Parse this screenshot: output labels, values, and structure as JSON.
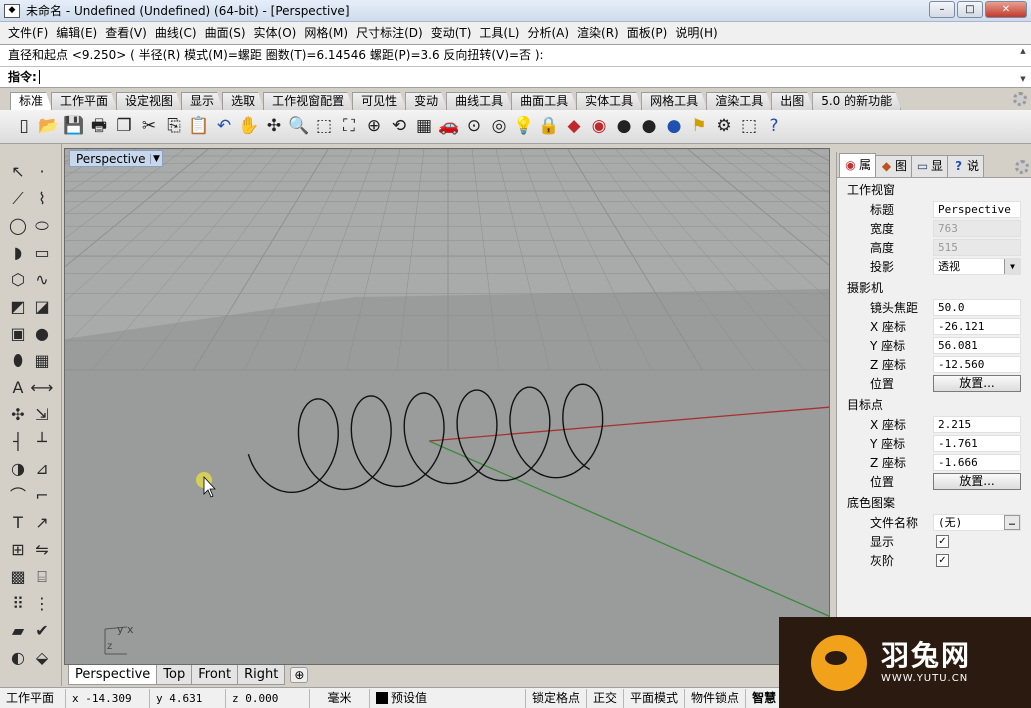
{
  "window": {
    "title": "未命名 - Undefined (Undefined) (64-bit) - [Perspective]",
    "buttons": [
      "–",
      "□",
      "✕"
    ]
  },
  "menu": [
    "文件(F)",
    "编辑(E)",
    "查看(V)",
    "曲线(C)",
    "曲面(S)",
    "实体(O)",
    "网格(M)",
    "尺寸标注(D)",
    "变动(T)",
    "工具(L)",
    "分析(A)",
    "渲染(R)",
    "面板(P)",
    "说明(H)"
  ],
  "command": {
    "history": "直径和起点 <9.250> ( 半径(R)  模式(M)=螺距  圈数(T)=6.14546  螺距(P)=3.6  反向扭转(V)=否 ):",
    "prompt": "指令:",
    "value": ""
  },
  "toolbar_tabs": [
    "标准",
    "工作平面",
    "设定视图",
    "显示",
    "选取",
    "工作视窗配置",
    "可见性",
    "变动",
    "曲线工具",
    "曲面工具",
    "实体工具",
    "网格工具",
    "渲染工具",
    "出图",
    "5.0 的新功能"
  ],
  "toolbar_icons": [
    {
      "name": "new-icon",
      "glyph": "▯"
    },
    {
      "name": "open-icon",
      "glyph": "📂"
    },
    {
      "name": "save-icon",
      "glyph": "💾"
    },
    {
      "name": "print-icon",
      "glyph": "🖶"
    },
    {
      "name": "copy-page-icon",
      "glyph": "❐"
    },
    {
      "name": "cut-icon",
      "glyph": "✂"
    },
    {
      "name": "copy-icon",
      "glyph": "⎘"
    },
    {
      "name": "paste-icon",
      "glyph": "📋"
    },
    {
      "name": "undo-icon",
      "glyph": "↶"
    },
    {
      "name": "pan-icon",
      "glyph": "✋"
    },
    {
      "name": "rotate-view-icon",
      "glyph": "✣"
    },
    {
      "name": "zoom-icon",
      "glyph": "🔍"
    },
    {
      "name": "zoom-window-icon",
      "glyph": "⬚"
    },
    {
      "name": "zoom-extents-icon",
      "glyph": "⛶"
    },
    {
      "name": "zoom-selected-icon",
      "glyph": "⊕"
    },
    {
      "name": "undo-view-icon",
      "glyph": "⟲"
    },
    {
      "name": "grid-icon",
      "glyph": "▦"
    },
    {
      "name": "car-icon",
      "glyph": "🚗"
    },
    {
      "name": "camera-icon",
      "glyph": "⊙"
    },
    {
      "name": "target-icon",
      "glyph": "◎"
    },
    {
      "name": "light-icon",
      "glyph": "💡"
    },
    {
      "name": "layer-icon",
      "glyph": "🔒"
    },
    {
      "name": "layer-color-icon",
      "glyph": "◆"
    },
    {
      "name": "color-wheel-icon",
      "glyph": "◉"
    },
    {
      "name": "sphere-wire-icon",
      "glyph": "●"
    },
    {
      "name": "sphere-shaded-icon",
      "glyph": "●"
    },
    {
      "name": "sphere-render-icon",
      "glyph": "●"
    },
    {
      "name": "flag-icon",
      "glyph": "⚑"
    },
    {
      "name": "options-icon",
      "glyph": "⚙"
    },
    {
      "name": "select-all-icon",
      "glyph": "⬚"
    },
    {
      "name": "help-icon",
      "glyph": "?"
    }
  ],
  "left_tools": [
    [
      {
        "name": "select-arrow-icon",
        "glyph": "↖"
      },
      {
        "name": "point-icon",
        "glyph": "·"
      }
    ],
    [
      {
        "name": "polyline-icon",
        "glyph": "⟋"
      },
      {
        "name": "curve-icon",
        "glyph": "⌇"
      }
    ],
    [
      {
        "name": "circle-icon",
        "glyph": "◯"
      },
      {
        "name": "ellipse-icon",
        "glyph": "⬭"
      }
    ],
    [
      {
        "name": "arc-icon",
        "glyph": "◗"
      },
      {
        "name": "rectangle-icon",
        "glyph": "▭"
      }
    ],
    [
      {
        "name": "polygon-icon",
        "glyph": "⬡"
      },
      {
        "name": "freeform-icon",
        "glyph": "∿"
      }
    ],
    [
      {
        "name": "surface-icon",
        "glyph": "◩"
      },
      {
        "name": "surface-edit-icon",
        "glyph": "◪"
      }
    ],
    [
      {
        "name": "box-icon",
        "glyph": "▣"
      },
      {
        "name": "sphere-icon",
        "glyph": "●"
      }
    ],
    [
      {
        "name": "cylinder-icon",
        "glyph": "⬮"
      },
      {
        "name": "mesh-icon",
        "glyph": "▦"
      }
    ],
    [
      {
        "name": "text-object-icon",
        "glyph": "A"
      },
      {
        "name": "dim-icon",
        "glyph": "⟷"
      }
    ],
    [
      {
        "name": "transform-icon",
        "glyph": "✣"
      },
      {
        "name": "move-icon",
        "glyph": "⇲"
      }
    ],
    [
      {
        "name": "trim-icon",
        "glyph": "┤"
      },
      {
        "name": "split-icon",
        "glyph": "┴"
      }
    ],
    [
      {
        "name": "boolean-icon",
        "glyph": "◑"
      },
      {
        "name": "offset-icon",
        "glyph": "⊿"
      }
    ],
    [
      {
        "name": "fillet-icon",
        "glyph": "⌒"
      },
      {
        "name": "chamfer-icon",
        "glyph": "⌐"
      }
    ],
    [
      {
        "name": "text-icon",
        "glyph": "T"
      },
      {
        "name": "leader-icon",
        "glyph": "↗"
      }
    ],
    [
      {
        "name": "array-icon",
        "glyph": "⊞"
      },
      {
        "name": "mirror-icon",
        "glyph": "⇋"
      }
    ],
    [
      {
        "name": "solid-box-icon",
        "glyph": "▩"
      },
      {
        "name": "analysis-icon",
        "glyph": "⌸"
      }
    ],
    [
      {
        "name": "grid-points-icon",
        "glyph": "⠿"
      },
      {
        "name": "control-points-icon",
        "glyph": "⋮"
      }
    ],
    [
      {
        "name": "layers-icon",
        "glyph": "▰"
      },
      {
        "name": "check-icon",
        "glyph": "✔"
      }
    ],
    [
      {
        "name": "render-icon",
        "glyph": "◐"
      },
      {
        "name": "lamp-icon",
        "glyph": "⬙"
      }
    ]
  ],
  "viewport": {
    "title": "Perspective",
    "axis_label": "y x\nz"
  },
  "viewport_tabs": [
    "Perspective",
    "Top",
    "Front",
    "Right"
  ],
  "panel": {
    "tabs": [
      {
        "icon": "◉",
        "label": "属"
      },
      {
        "icon": "◆",
        "label": "图"
      },
      {
        "icon": "▭",
        "label": "显"
      },
      {
        "icon": "?",
        "label": "说"
      }
    ],
    "sections": [
      {
        "title": "工作视窗",
        "rows": [
          {
            "label": "标题",
            "value": "Perspective",
            "type": "text"
          },
          {
            "label": "宽度",
            "value": "763",
            "type": "disabled"
          },
          {
            "label": "高度",
            "value": "515",
            "type": "disabled"
          },
          {
            "label": "投影",
            "value": "透视",
            "type": "select"
          }
        ]
      },
      {
        "title": "摄影机",
        "rows": [
          {
            "label": "镜头焦距",
            "value": "50.0",
            "type": "text"
          },
          {
            "label": "X 座标",
            "value": "-26.121",
            "type": "text"
          },
          {
            "label": "Y 座标",
            "value": "56.081",
            "type": "text"
          },
          {
            "label": "Z 座标",
            "value": "-12.560",
            "type": "text"
          },
          {
            "label": "位置",
            "value": "放置...",
            "type": "button"
          }
        ]
      },
      {
        "title": "目标点",
        "rows": [
          {
            "label": "X 座标",
            "value": "2.215",
            "type": "text"
          },
          {
            "label": "Y 座标",
            "value": "-1.761",
            "type": "text"
          },
          {
            "label": "Z 座标",
            "value": "-1.666",
            "type": "text"
          },
          {
            "label": "位置",
            "value": "放置...",
            "type": "button"
          }
        ]
      },
      {
        "title": "底色图案",
        "rows": [
          {
            "label": "文件名称",
            "value": "(无)",
            "type": "file"
          },
          {
            "label": "显示",
            "value": "✓",
            "type": "check"
          },
          {
            "label": "灰阶",
            "value": "✓",
            "type": "check"
          }
        ]
      }
    ]
  },
  "status": {
    "cplane": "工作平面",
    "x": "x -14.309",
    "y": "y 4.631",
    "z": "z 0.000",
    "units": "毫米",
    "layer": "预设值",
    "snaps": [
      "锁定格点",
      "正交",
      "平面模式",
      "物件锁点",
      "智慧"
    ]
  },
  "logo": {
    "cn": "羽兔网",
    "url": "WWW.YUTU.CN"
  },
  "colors": {
    "x_axis": "#a83030",
    "y_axis": "#3a8a3a",
    "viewport_bg": "#9a9c9c",
    "grid": "#8c8e8e",
    "helix": "#111111",
    "cursor_highlight": "#e8e040",
    "logo_bg": "#2b1a10",
    "logo_mark": "#f2a21a"
  }
}
